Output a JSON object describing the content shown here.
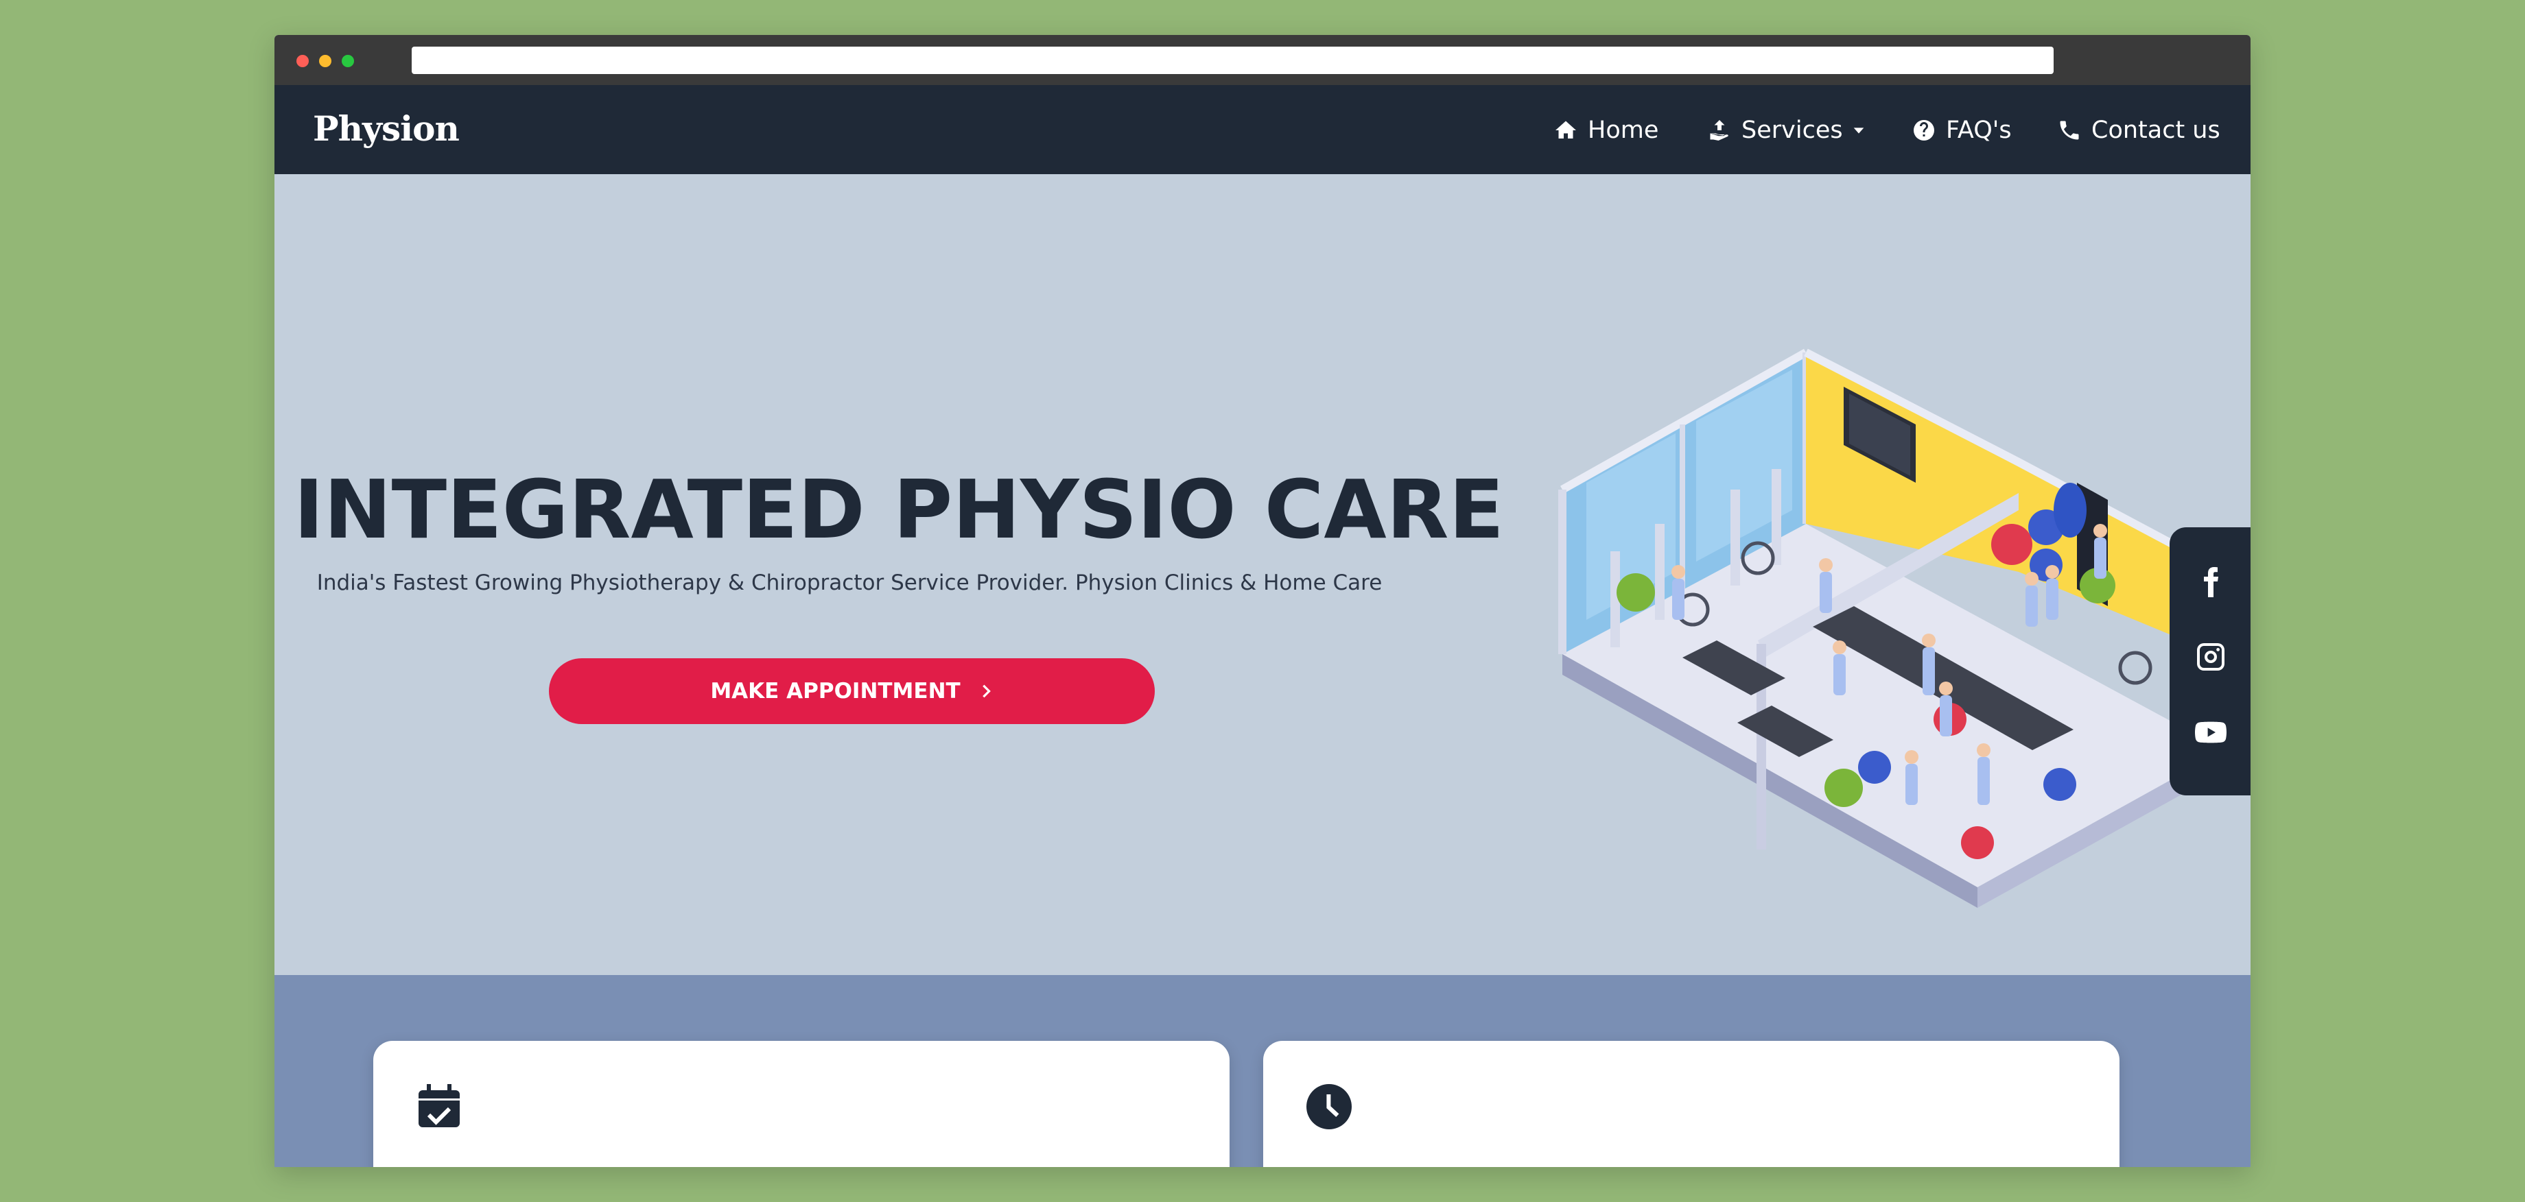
{
  "brand": {
    "name": "Physion"
  },
  "nav": {
    "items": [
      {
        "label": "Home",
        "icon": "home-icon"
      },
      {
        "label": "Services",
        "icon": "hand-upload-icon",
        "has_dropdown": true
      },
      {
        "label": "FAQ's",
        "icon": "question-circle-icon"
      },
      {
        "label": "Contact us",
        "icon": "phone-icon"
      }
    ]
  },
  "hero": {
    "title": "INTEGRATED PHYSIO CARE",
    "subtitle": "India's Fastest Growing Physiotherapy & Chiropractor Service Provider. Physion Clinics & Home Care",
    "cta_label": "MAKE APPOINTMENT",
    "illustration": "isometric-physiotherapy-clinic-illustration"
  },
  "social": {
    "items": [
      {
        "icon": "facebook-icon"
      },
      {
        "icon": "instagram-icon"
      },
      {
        "icon": "youtube-icon"
      }
    ]
  },
  "cards": [
    {
      "icon": "calendar-check-icon"
    },
    {
      "icon": "clock-icon"
    }
  ],
  "colors": {
    "page_bg": "#93b776",
    "navbar_bg": "#1f2937",
    "hero_bg": "#c3cfdc",
    "band_bg": "#7a8fb4",
    "accent": "#e11d48",
    "text_dark": "#1f2937"
  }
}
